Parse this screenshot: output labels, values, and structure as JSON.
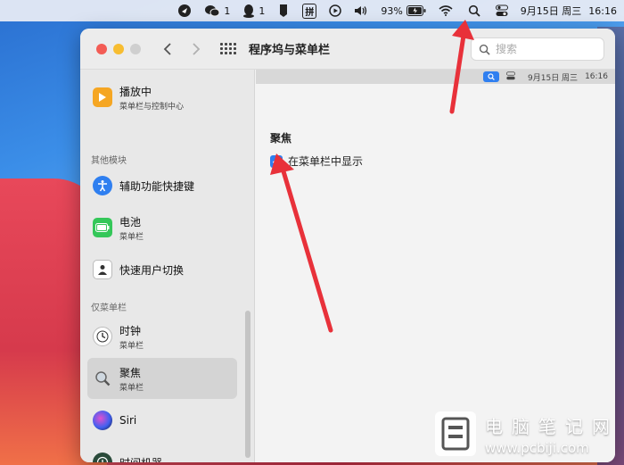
{
  "menubar": {
    "wechat_count": "1",
    "qq_count": "1",
    "input_method": "拼",
    "battery": "93%",
    "datetime_date": "9月15日 周三",
    "datetime_time": "16:16"
  },
  "window": {
    "title": "程序坞与菜单栏",
    "search_placeholder": "搜索"
  },
  "sidebar": {
    "items": [
      {
        "label": "播放中",
        "sub": "菜单栏与控制中心"
      },
      {
        "header": "其他模块"
      },
      {
        "label": "辅助功能快捷键",
        "sub": ""
      },
      {
        "label": "电池",
        "sub": "菜单栏"
      },
      {
        "label": "快速用户切换",
        "sub": ""
      },
      {
        "header": "仅菜单栏"
      },
      {
        "label": "时钟",
        "sub": "菜单栏"
      },
      {
        "label": "聚焦",
        "sub": "菜单栏",
        "selected": true
      },
      {
        "label": "Siri",
        "sub": ""
      },
      {
        "label": "时间机器",
        "sub": ""
      }
    ]
  },
  "content": {
    "preview_date": "9月15日 周三",
    "preview_time": "16:16",
    "section_title": "聚焦",
    "checkbox_label": "在菜单栏中显示",
    "checkbox_checked": true
  },
  "watermark": {
    "cn": "电脑笔记网",
    "url": "www.pcbiji.com"
  },
  "colors": {
    "accent": "#2f7ff0",
    "arrow": "#e8313a"
  }
}
